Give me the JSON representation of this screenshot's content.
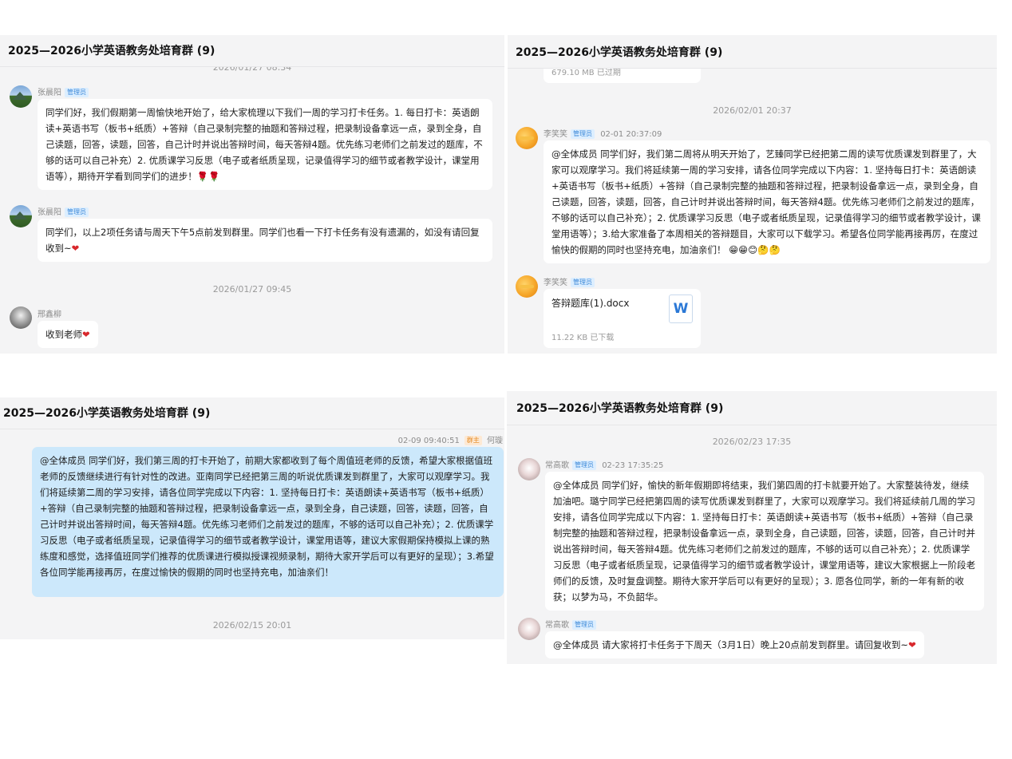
{
  "group_title": "2025—2026小学英语教务处培育群 (9)",
  "panel1": {
    "timestamp_top": "2026/01/27 08:34",
    "messages": [
      {
        "sender": "张晨阳",
        "role": "管理员",
        "text": "同学们好，我们假期第一周愉快地开始了，给大家梳理以下我们一周的学习打卡任务。1. 每日打卡：英语朗读+英语书写（板书+纸质）+答辩（自己录制完整的抽题和答辩过程，把录制设备拿远一点，录到全身，自己读题，回答，读题，回答，自己计时并说出答辩时间，每天答辩4题。优先练习老师们之前发过的题库，不够的话可以自己补充）2. 优质课学习反思（电子或者纸质呈现，记录值得学习的细节或者教学设计，课堂用语等），期待开学看到同学们的进步！",
        "emoji": "🌹🌹"
      },
      {
        "sender": "张晨阳",
        "role": "管理员",
        "text": "同学们，以上2项任务请与周天下午5点前发到群里。同学们也看一下打卡任务有没有遗漏的，如没有请回复收到~",
        "emoji": "❤"
      }
    ],
    "timestamp_2": "2026/01/27 09:45",
    "reply": {
      "sender": "邢鑫柳",
      "text": "收到老师",
      "emoji": "❤"
    }
  },
  "panel2": {
    "top_file_meta": "679.10 MB  已过期",
    "timestamp": "2026/02/01 20:37",
    "message": {
      "sender": "李笑笑",
      "role": "管理员",
      "time": "02-01 20:37:09",
      "text": "@全体成员 同学们好，我们第二周将从明天开始了，艺臻同学已经把第二周的读写优质课发到群里了，大家可以观摩学习。我们将延续第一周的学习安排，请各位同学完成以下内容：1. 坚持每日打卡：英语朗读+英语书写（板书+纸质）+答辩（自己录制完整的抽题和答辩过程，把录制设备拿远一点，录到全身，自己读题，回答，读题，回答，自己计时并说出答辩时间，每天答辩4题。优先练习老师们之前发过的题库，不够的话可以自己补充）；2. 优质课学习反思（电子或者纸质呈现，记录值得学习的细节或者教学设计，课堂用语等）；3.给大家准备了本周相关的答辩题目，大家可以下载学习。希望各位同学能再接再厉，在度过愉快的假期的同时也坚持充电，加油亲们！",
      "emoji": "😁😁😊🤔🤔"
    },
    "file": {
      "sender": "李笑笑",
      "role": "管理员",
      "filename": "答辩题库(1).docx",
      "icon_label": "W",
      "meta": "11.22 KB  已下载"
    }
  },
  "panel3": {
    "header": {
      "time": "02-09 09:40:51",
      "role": "群主",
      "sender": "何璇"
    },
    "text": "@全体成员 同学们好，我们第三周的打卡开始了，前期大家都收到了每个周值班老师的反馈，希望大家根据值班老师的反馈继续进行有针对性的改进。亚南同学已经把第三周的听说优质课发到群里了，大家可以观摩学习。我们将延续第二周的学习安排，请各位同学完成以下内容：1. 坚持每日打卡：英语朗读+英语书写（板书+纸质）+答辩（自己录制完整的抽题和答辩过程，把录制设备拿远一点，录到全身，自己读题，回答，读题，回答，自己计时并说出答辩时间，每天答辩4题。优先练习老师们之前发过的题库，不够的话可以自己补充）；2. 优质课学习反思（电子或者纸质呈现，记录值得学习的细节或者教学设计，课堂用语等，建议大家假期保持模拟上课的熟练度和感觉，选择值班同学们推荐的优质课进行模拟授课视频录制，期待大家开学后可以有更好的呈现）；3.希望各位同学能再接再厉，在度过愉快的假期的同时也坚持充电，加油亲们！",
    "timestamp_bottom": "2026/02/15 20:01"
  },
  "panel4": {
    "timestamp": "2026/02/23 17:35",
    "message": {
      "sender": "常高歌",
      "role": "管理员",
      "time": "02-23 17:35:25",
      "text": "@全体成员 同学们好，愉快的新年假期即将结束，我们第四周的打卡就要开始了。大家整装待发，继续加油吧。璐宁同学已经把第四周的读写优质课发到群里了，大家可以观摩学习。我们将延续前几周的学习安排，请各位同学完成以下内容：1. 坚持每日打卡：英语朗读+英语书写（板书+纸质）+答辩（自己录制完整的抽题和答辩过程，把录制设备拿远一点，录到全身，自己读题，回答，读题，回答，自己计时并说出答辩时间，每天答辩4题。优先练习老师们之前发过的题库，不够的话可以自己补充）；2. 优质课学习反思（电子或者纸质呈现，记录值得学习的细节或者教学设计，课堂用语等，建议大家根据上一阶段老师们的反馈，及时复盘调整。期待大家开学后可以有更好的呈现）；3. 愿各位同学，新的一年有新的收获；以梦为马，不负韶华。"
    },
    "message2": {
      "sender": "常高歌",
      "role": "管理员",
      "text": "@全体成员 请大家将打卡任务于下周天（3月1日）晚上20点前发到群里。请回复收到~",
      "emoji": "❤"
    }
  }
}
